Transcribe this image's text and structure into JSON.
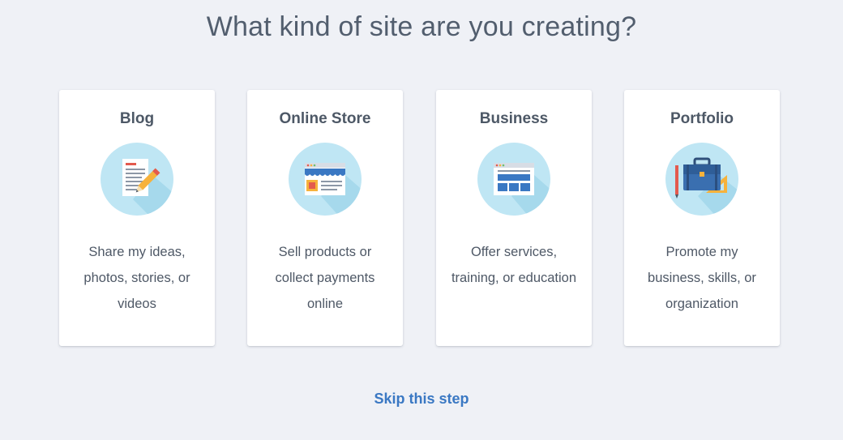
{
  "page": {
    "title": "What kind of site are you creating?"
  },
  "cards": [
    {
      "title": "Blog",
      "icon": "blog-document-pencil-icon",
      "description": "Share my ideas, photos, stories, or videos"
    },
    {
      "title": "Online Store",
      "icon": "storefront-icon",
      "description": "Sell products or collect payments online"
    },
    {
      "title": "Business",
      "icon": "browser-window-icon",
      "description": "Offer services, training, or education"
    },
    {
      "title": "Portfolio",
      "icon": "briefcase-icon",
      "description": "Promote my business, skills, or organization"
    }
  ],
  "skip": {
    "label": "Skip this step"
  },
  "colors": {
    "background": "#eff1f6",
    "card": "#ffffff",
    "icon_circle": "#bfe6f4",
    "link": "#3a78c3",
    "title_text": "#525e6e"
  }
}
